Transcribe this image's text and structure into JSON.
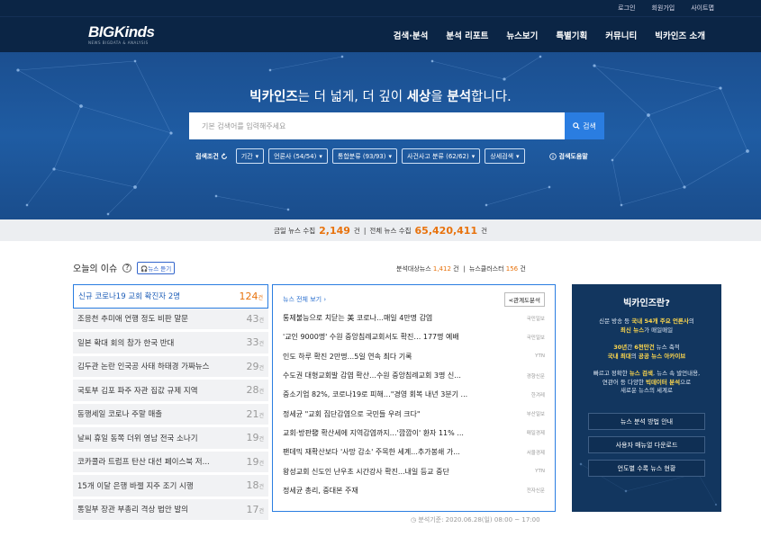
{
  "topbar": {
    "links": [
      "로그인",
      "회원가입",
      "사이트맵"
    ]
  },
  "logo": {
    "main": "BIGKinds",
    "sub": "NEWS BIGDATA & ANALYSIS"
  },
  "menu": [
    "검색·분석",
    "분석 리포트",
    "뉴스보기",
    "특별기획",
    "커뮤니티",
    "빅카인즈 소개"
  ],
  "hero": {
    "title_part1": "빅카인즈",
    "title_part2": "는 더 넓게, 더 깊이 ",
    "title_part3": "세상",
    "title_part4": "을 ",
    "title_part5": "분석",
    "title_part6": "합니다."
  },
  "search": {
    "placeholder": "기본 검색어를 입력해주세요",
    "button_label": "검색"
  },
  "filters": {
    "label": "검색조건",
    "chips": [
      "기간",
      "언론사 (54/54)",
      "통합분류 (93/93)",
      "사건사고 분류 (62/62)",
      "상세검색"
    ],
    "help": "검색도움말"
  },
  "stats": {
    "today_label": "금일 뉴스 수집",
    "today_value": "2,149",
    "unit": "건",
    "divider": "|",
    "total_label": "전체 뉴스 수집",
    "total_value": "65,420,411"
  },
  "issues_section": {
    "title": "오늘의 이슈",
    "listen_label": "뉴스 듣기",
    "analysis_label": "분석대상뉴스",
    "analysis_value": "1,412",
    "cluster_label": "뉴스클러스터",
    "cluster_value": "156",
    "unit": "건",
    "divider": "|"
  },
  "issues": [
    {
      "title": "신규 코로나19 교회 확진자 2명",
      "count": "124"
    },
    {
      "title": "조응천 추미애 언행 정도 비판 말문",
      "count": "43"
    },
    {
      "title": "일본 확대 회의 참가 한국 반대",
      "count": "33"
    },
    {
      "title": "김두관 논란 인국공 사태 하태경 가짜뉴스",
      "count": "29"
    },
    {
      "title": "국토부 김포 파주 자관 집값 규제 지역",
      "count": "28"
    },
    {
      "title": "동행세일 코로나 주말 매출",
      "count": "21"
    },
    {
      "title": "날씨 휴일 동쪽 더위 영남 전국 소나기",
      "count": "19"
    },
    {
      "title": "코카콜라 트럼프 탄산 대선 페이스북 저...",
      "count": "19"
    },
    {
      "title": "15개 이달 은행 바젤 지주 조기 시행",
      "count": "18"
    },
    {
      "title": "통일부 장관 부총리 격상 법안 발의",
      "count": "17"
    }
  ],
  "count_unit": "건",
  "news_panel": {
    "all_label": "뉴스 전체 보기",
    "related_label": "관계도분석"
  },
  "news": [
    {
      "title": "통제불능으로 치닫는 美 코로나…매일 4만명 감염",
      "source": "국민일보"
    },
    {
      "title": "'교인 9000명' 수원 중앙침례교회서도 확진… 177명 예배",
      "source": "국민일보"
    },
    {
      "title": "인도 하루 확진 2만명...5일 연속 최다 기록",
      "source": "YTN"
    },
    {
      "title": "수도권 대형교회발 감염 확산…수원 중앙침례교회 3명 신...",
      "source": "경향신문"
    },
    {
      "title": "중소기업 82%, 코로나19로 피해…\"경영 회복 내년 3분기 ...",
      "source": "한겨레"
    },
    {
      "title": "정세균 \"교회 집단감염으로 국민들 우려 크다\"",
      "source": "부산일보"
    },
    {
      "title": "교회·방판發 확산세에 지역감염까지…'깜깜이' 환자 11% ...",
      "source": "매일경제"
    },
    {
      "title": "팬데믹 재확산보다 '사망 감소' 주목한 세계...추가봉쇄 가...",
      "source": "서울경제"
    },
    {
      "title": "왕성교회 신도인 난우초 시간강사 확진...내일 등교 중단",
      "source": "YTN"
    },
    {
      "title": "정세균 총리, 중대본 주재",
      "source": "전자신문"
    }
  ],
  "sidebar": {
    "title": "빅카인즈란?",
    "p1_a": "신문 방송 등 ",
    "p1_b": "국내 54개 주요 언론사",
    "p1_c": "의",
    "p1_d": "최신 뉴스",
    "p1_e": "가 매일매일",
    "p2_a": "30년",
    "p2_b": "간 ",
    "p2_c": "6천만건",
    "p2_d": " 뉴스 축적",
    "p2_e": "국내 최대",
    "p2_f": "의 ",
    "p2_g": "공공 뉴스 아카이브",
    "p3_a": "빠르고 정확한 ",
    "p3_b": "뉴스 검색",
    "p3_c": ", 뉴스 속 발언내용,",
    "p3_d": "연관어 등 다양한 ",
    "p3_e": "빅데이터 분석",
    "p3_f": "으로",
    "p3_g": "새로운 뉴스의 세계로",
    "buttons": [
      "뉴스 분석 방법 안내",
      "사용자 매뉴얼 다운로드",
      "언도별 수록 뉴스 현황"
    ]
  },
  "footnote": "분석기준: 2020.06.28(일) 08:00 ~ 17:00",
  "colors": {
    "navy": "#0b2545",
    "hero": "#1f5ca3",
    "accent": "#2a7de1",
    "orange": "#e8720c",
    "yellow": "#ffd84d"
  }
}
